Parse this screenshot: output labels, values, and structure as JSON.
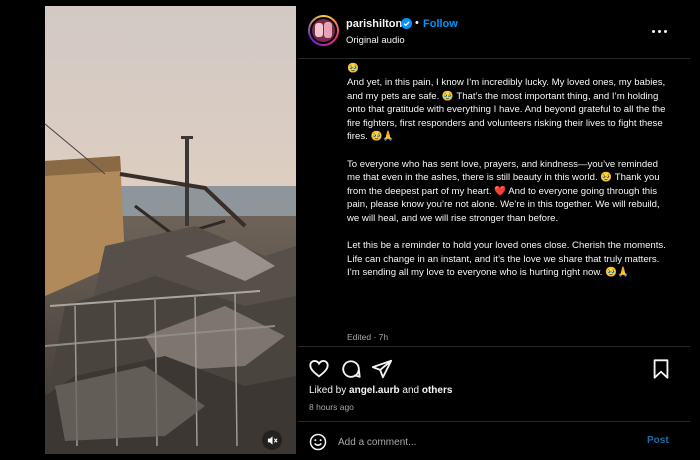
{
  "post": {
    "username": "parishilton",
    "separator": "•",
    "follow_label": "Follow",
    "subtitle": "Original audio",
    "verified_icon": "verified-badge-icon",
    "more_icon": "more-options-icon"
  },
  "caption": {
    "paragraphs": [
      "And yet, in this pain, I know I’m incredibly lucky. My loved ones, my babies, and my pets are safe. 🥹 That’s the most important thing, and I’m holding onto that gratitude with everything I have. And beyond grateful to all the the fire fighters, first responders and volunteers risking their lives to fight these fires. 🥹🙏",
      "To everyone who has sent love, prayers, and kindness—you’ve reminded me that even in the ashes, there is still beauty in this world. 🥹 Thank you from the deepest part of my heart. ❤️ And to everyone going through this pain, please know you’re not alone. We’re in this together. We will rebuild, we will heal, and we will rise stronger than before.",
      "Let this be a reminder to hold your loved ones close. Cherish the moments. Life can change in an instant, and it’s the love we share that truly matters. I’m sending all my love to everyone who is hurting right now. 🥹🙏"
    ],
    "cut_emoji": "🥹",
    "edited": "Edited · 7h"
  },
  "engagement": {
    "liked_prefix": "Liked by ",
    "liked_user": "angel.aurb",
    "liked_mid": " and ",
    "liked_others": "others",
    "time_ago": "8 hours ago"
  },
  "comment": {
    "placeholder": "Add a comment...",
    "post_label": "Post"
  },
  "colors": {
    "accent_blue": "#0095f6",
    "background": "#000000",
    "muted_text": "#a8a8a8"
  }
}
